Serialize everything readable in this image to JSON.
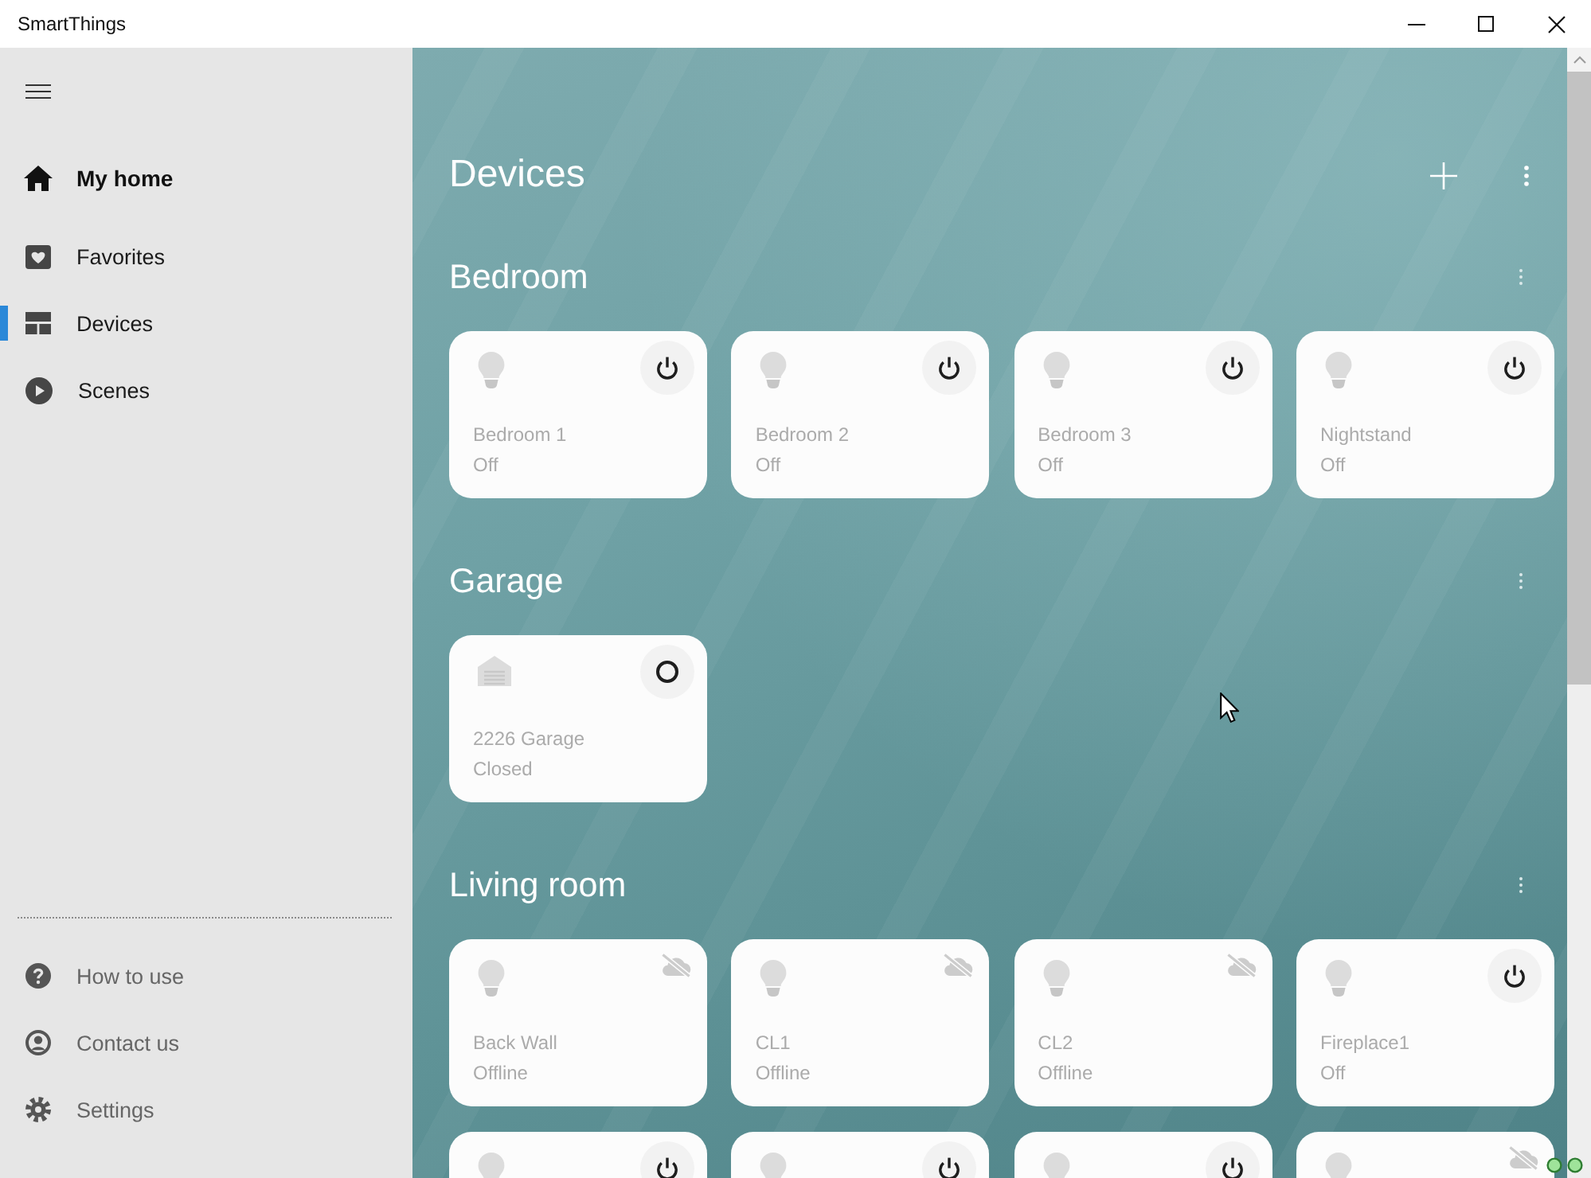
{
  "window": {
    "title": "SmartThings"
  },
  "sidebar": {
    "location": {
      "label": "My home"
    },
    "items": [
      {
        "label": "Favorites",
        "selected": false
      },
      {
        "label": "Devices",
        "selected": true
      },
      {
        "label": "Scenes",
        "selected": false
      }
    ],
    "footer_items": [
      {
        "label": "How to use"
      },
      {
        "label": "Contact us"
      },
      {
        "label": "Settings"
      }
    ]
  },
  "page": {
    "title": "Devices"
  },
  "rooms": [
    {
      "name": "Bedroom",
      "devices": [
        {
          "kind": "light",
          "name": "Bedroom 1",
          "status": "Off",
          "offline": false
        },
        {
          "kind": "light",
          "name": "Bedroom 2",
          "status": "Off",
          "offline": false
        },
        {
          "kind": "light",
          "name": "Bedroom 3",
          "status": "Off",
          "offline": false
        },
        {
          "kind": "light",
          "name": "Nightstand",
          "status": "Off",
          "offline": false
        }
      ]
    },
    {
      "name": "Garage",
      "devices": [
        {
          "kind": "garage",
          "name": "2226 Garage",
          "status": "Closed",
          "offline": false
        }
      ]
    },
    {
      "name": "Living room",
      "devices": [
        {
          "kind": "light",
          "name": "Back Wall",
          "status": "Offline",
          "offline": true
        },
        {
          "kind": "light",
          "name": "CL1",
          "status": "Offline",
          "offline": true
        },
        {
          "kind": "light",
          "name": "CL2",
          "status": "Offline",
          "offline": true
        },
        {
          "kind": "light",
          "name": "Fireplace1",
          "status": "Off",
          "offline": false
        },
        {
          "kind": "light",
          "offline": false
        },
        {
          "kind": "light",
          "offline": false
        },
        {
          "kind": "light",
          "offline": false
        },
        {
          "kind": "light",
          "offline": true
        }
      ]
    }
  ]
}
